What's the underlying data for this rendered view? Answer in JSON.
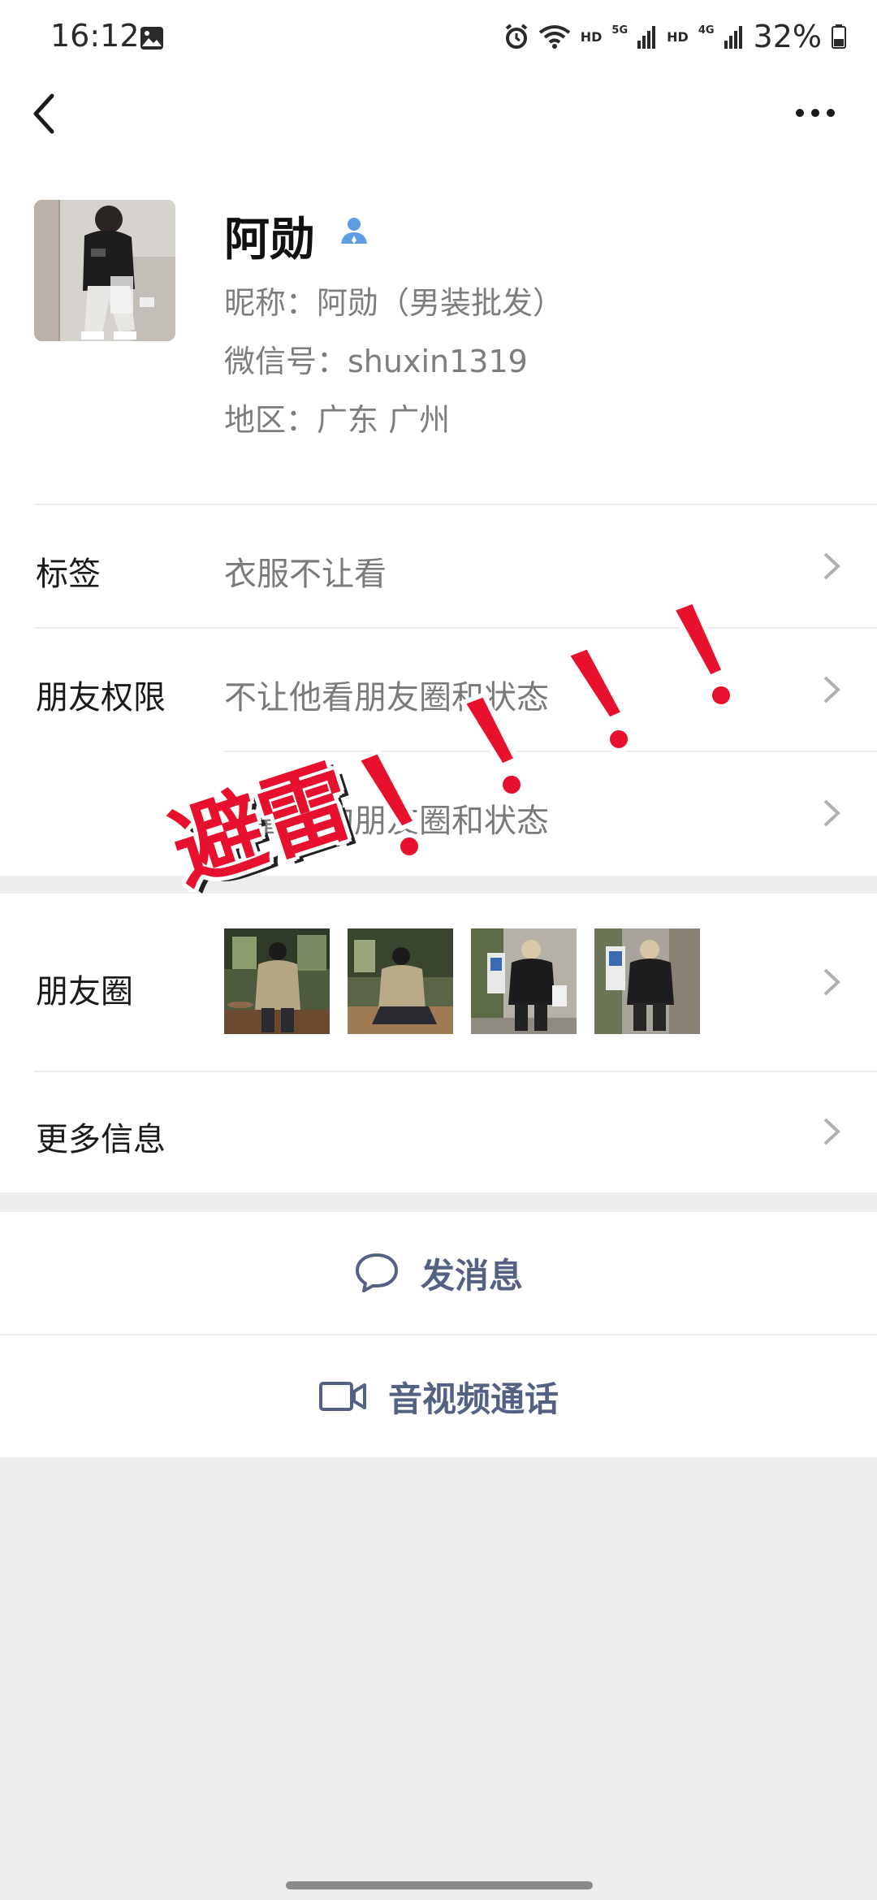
{
  "status_bar": {
    "time": "16:12",
    "hd1": "HD",
    "gen1": "5G",
    "hd2": "HD",
    "gen2": "4G",
    "battery": "32%"
  },
  "profile": {
    "name": "阿勋",
    "nickname": "昵称：阿勋（男装批发）",
    "wechat_id": "微信号：shuxin1319",
    "region": "地区：广东  广州"
  },
  "rows": {
    "tags_label": "标签",
    "tags_value": "衣服不让看",
    "permission_label": "朋友权限",
    "permission_value1": "不让他看朋友圈和状态",
    "permission_value2": "不看他的朋友圈和状态",
    "moments_label": "朋友圈",
    "more_info_label": "更多信息"
  },
  "actions": {
    "message_label": "发消息",
    "call_label": "音视频通话"
  },
  "sticker": {
    "text": "避雷"
  },
  "colors": {
    "link_blue": "#556085",
    "accent_red": "#e8112d",
    "background": "#ededed"
  },
  "icons": {
    "back": "chevron-left-icon",
    "more": "more-dots-icon",
    "contact_badge": "person-icon",
    "message": "chat-bubble-icon",
    "call": "video-camera-icon"
  }
}
